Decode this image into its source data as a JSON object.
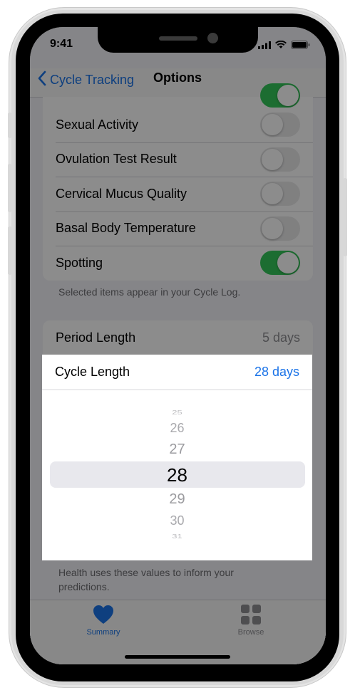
{
  "status_bar": {
    "time": "9:41"
  },
  "nav": {
    "back_label": "Cycle Tracking",
    "title": "Options"
  },
  "options_list": {
    "rows": [
      {
        "label": "Sexual Activity",
        "enabled": false
      },
      {
        "label": "Ovulation Test Result",
        "enabled": false
      },
      {
        "label": "Cervical Mucus Quality",
        "enabled": false
      },
      {
        "label": "Basal Body Temperature",
        "enabled": false
      },
      {
        "label": "Spotting",
        "enabled": true
      }
    ],
    "footnote": "Selected items appear in your Cycle Log."
  },
  "period_length": {
    "label": "Period Length",
    "value": "5 days"
  },
  "cycle_length": {
    "label": "Cycle Length",
    "value": "28 days"
  },
  "picker": {
    "values": [
      "25",
      "26",
      "27",
      "28",
      "29",
      "30",
      "31"
    ],
    "selected": "28"
  },
  "predictions_footnote": "Health uses these values to inform your predictions.",
  "tabbar": {
    "tabs": [
      {
        "label": "Summary",
        "icon": "heart-icon",
        "active": true
      },
      {
        "label": "Browse",
        "icon": "grid-icon",
        "active": false
      }
    ]
  },
  "colors": {
    "accent": "#1a73e8",
    "toggle_on": "#34c759"
  }
}
